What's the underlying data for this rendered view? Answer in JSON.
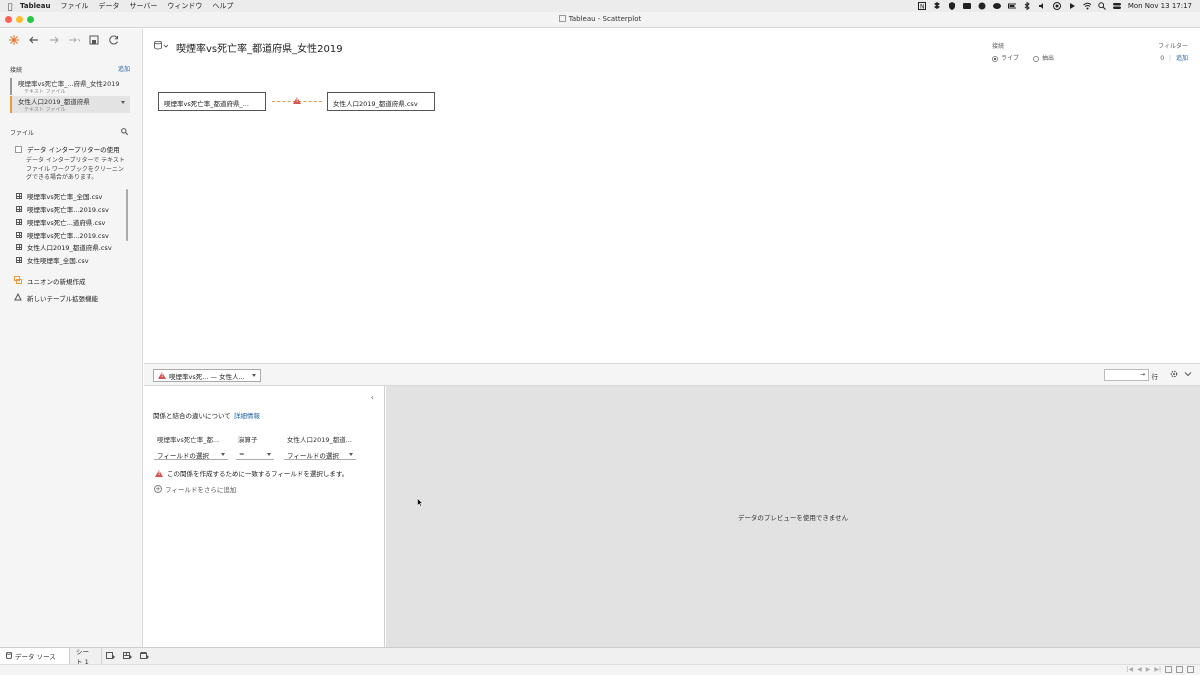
{
  "menubar": {
    "app_name": "Tableau",
    "items": [
      "ファイル",
      "データ",
      "サーバー",
      "ウィンドウ",
      "ヘルプ"
    ],
    "clock": "Mon Nov 13  17:17"
  },
  "window": {
    "title": "Tableau - Scatterplot"
  },
  "sidebar": {
    "connections_label": "接続",
    "add_label": "追加",
    "connections": [
      {
        "name": "喫煙率vs死亡率_...府県_女性2019",
        "type": "テキスト ファイル"
      },
      {
        "name": "女性人口2019_都道府県",
        "type": "テキスト ファイル"
      }
    ],
    "files_label": "ファイル",
    "interpreter_label": "データ インタープリターの使用",
    "interpreter_help": "データ インタープリターで テキスト ファイル ワークブックをクリーニングできる場合があります。",
    "files": [
      "喫煙率vs死亡率_全国.csv",
      "喫煙率vs死亡率...2019.csv",
      "喫煙率vs死亡...道府県.csv",
      "喫煙率vs死亡率...2019.csv",
      "女性人口2019_都道府県.csv",
      "女性喫煙率_全国.csv"
    ],
    "new_union": "ユニオンの新規作成",
    "new_table_ext": "新しいテーブル拡張機能"
  },
  "canvas": {
    "datasource_title": "喫煙率vs死亡率_都道府県_女性2019",
    "left_table": "喫煙率vs死亡率_都道府県_...",
    "right_table": "女性人口2019_都道府県.csv",
    "connection_label": "接続",
    "live_label": "ライブ",
    "extract_label": "抽出",
    "filter_label": "フィルター",
    "filter_count": "0",
    "filter_add": "追加"
  },
  "splitbar": {
    "relationship": "喫煙率vs死...  —  女性人...",
    "rows_label": "行"
  },
  "rel_editor": {
    "help_text": "関係と結合の違いについて",
    "help_link": "詳細情報",
    "left_col": "喫煙率vs死亡率_都...",
    "op_col": "演算子",
    "right_col": "女性人口2019_都道...",
    "left_select": "フィールドの選択",
    "op_select": "=",
    "right_select": "フィールドの選択",
    "warning": "この関係を作成するために一致するフィールドを選択します。",
    "add_more": "フィールドをさらに追加"
  },
  "preview": {
    "message": "データのプレビューを使用できません"
  },
  "tabs": {
    "datasource": "データ ソース",
    "sheet1": "シート 1"
  },
  "colors": {
    "accent": "#e89a3c",
    "warning": "#d9534f",
    "link": "#1f5f9f"
  }
}
